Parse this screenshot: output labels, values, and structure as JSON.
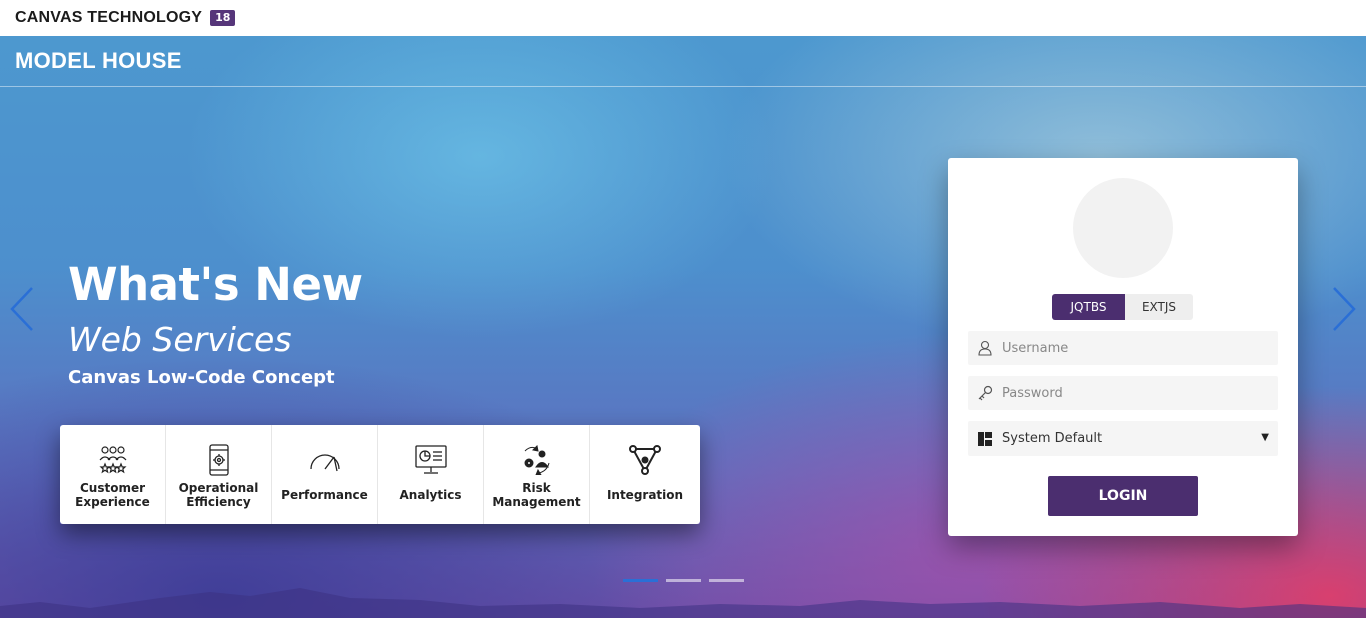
{
  "topbar": {
    "brand": "CANVAS TECHNOLOGY",
    "version": "18"
  },
  "hero": {
    "section_title": "MODEL HOUSE",
    "headline": "What's New",
    "subline": "Web Services",
    "tagline": "Canvas Low-Code Concept",
    "carousel": {
      "slides": 3,
      "active": 1
    }
  },
  "features": [
    {
      "label": "Customer Experience",
      "icon": "customer-experience-icon"
    },
    {
      "label": "Operational Efficiency",
      "icon": "operational-efficiency-icon"
    },
    {
      "label": "Performance",
      "icon": "performance-gauge-icon"
    },
    {
      "label": "Analytics",
      "icon": "analytics-icon"
    },
    {
      "label": "Risk Management",
      "icon": "risk-management-icon"
    },
    {
      "label": "Integration",
      "icon": "integration-icon"
    }
  ],
  "login": {
    "toggle_active": "JQTBS",
    "toggle_inactive": "EXTJS",
    "username_placeholder": "Username",
    "password_placeholder": "Password",
    "theme_selected": "System Default",
    "login_label": "LOGIN"
  },
  "colors": {
    "accent": "#4b2e6f",
    "version_badge": "#56367a",
    "arrow": "#2a6fd6"
  }
}
